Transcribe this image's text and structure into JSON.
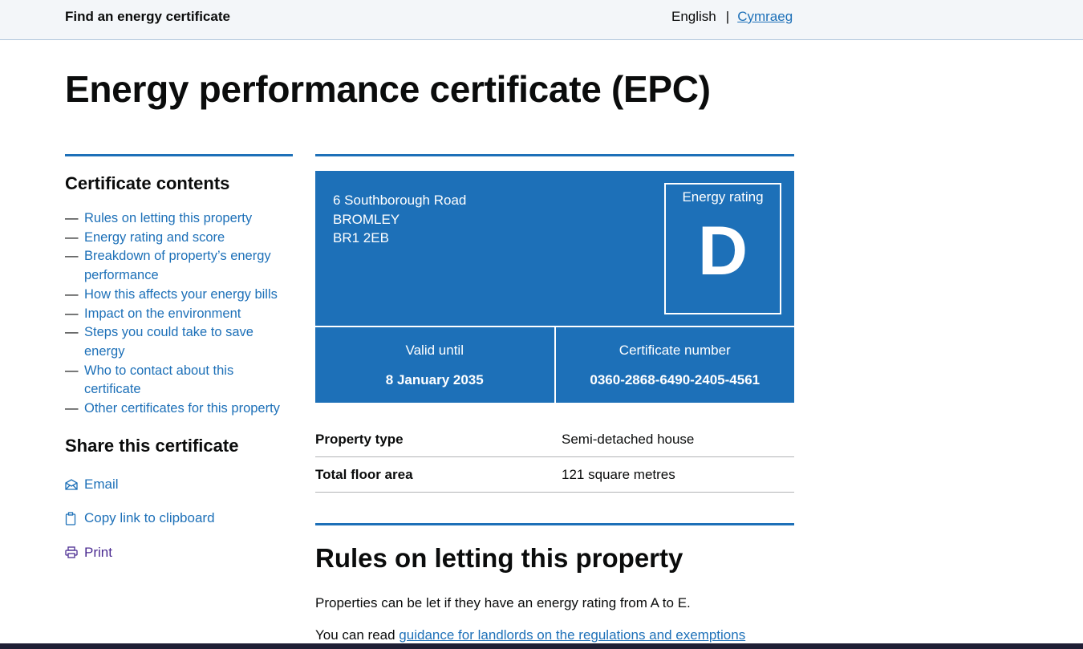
{
  "header": {
    "service_name": "Find an energy certificate",
    "lang_current": "English",
    "lang_separator": "|",
    "lang_alt": "Cymraeg"
  },
  "page_title": "Energy performance certificate (EPC)",
  "sidebar": {
    "contents_title": "Certificate contents",
    "dash": "—",
    "items": [
      {
        "label": "Rules on letting this property"
      },
      {
        "label": "Energy rating and score"
      },
      {
        "label": "Breakdown of property’s energy performance"
      },
      {
        "label": "How this affects your energy bills"
      },
      {
        "label": "Impact on the environment"
      },
      {
        "label": "Steps you could take to save energy"
      },
      {
        "label": "Who to contact about this certificate"
      },
      {
        "label": "Other certificates for this property"
      }
    ],
    "share_title": "Share this certificate",
    "share": {
      "email": "Email",
      "copy": "Copy link to clipboard",
      "print": "Print"
    }
  },
  "certificate": {
    "address_line1": "6 Southborough Road",
    "address_line2": "BROMLEY",
    "address_line3": "BR1 2EB",
    "rating_label": "Energy rating",
    "rating": "D",
    "valid_label": "Valid until",
    "valid_value": "8 January 2035",
    "number_label": "Certificate number",
    "number_value": "0360-2868-6490-2405-4561"
  },
  "summary": {
    "property_type_label": "Property type",
    "property_type_value": "Semi-detached house",
    "floor_area_label": "Total floor area",
    "floor_area_value": "121 square metres"
  },
  "letting": {
    "title": "Rules on letting this property",
    "para1": "Properties can be let if they have an energy rating from A to E.",
    "para2_prefix": "You can read ",
    "para2_link": "guidance for landlords on the regulations and exemptions"
  },
  "colors": {
    "brand_blue": "#1d70b8",
    "text": "#0b0c0c",
    "visited_link": "#4c2c92"
  }
}
